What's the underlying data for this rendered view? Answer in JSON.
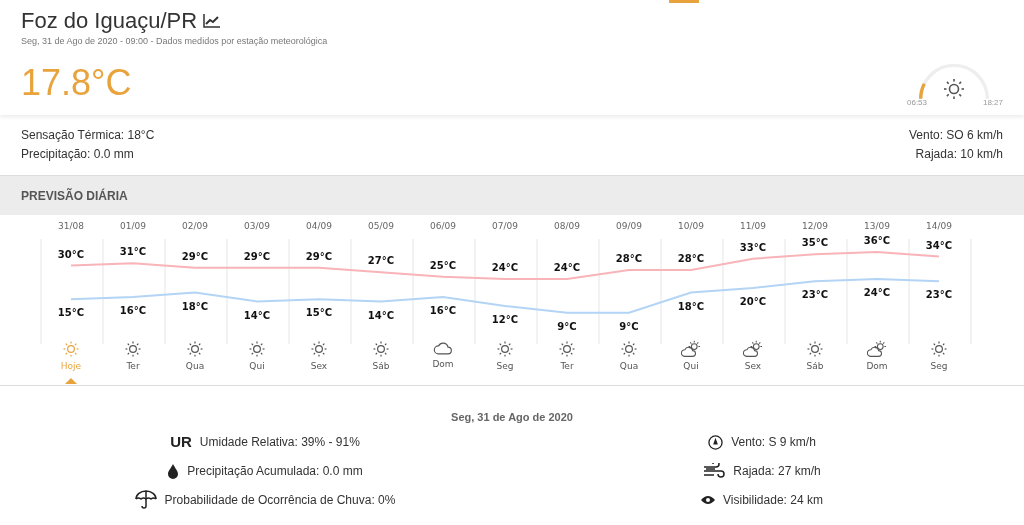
{
  "header": {
    "city": "Foz do Iguaçu/PR",
    "subtitle": "Seg, 31 de Ago de 2020 - 09:00 - Dados medidos por estação meteorológica",
    "temperature": "17.8°C",
    "sun": {
      "level": 0.15,
      "sunrise": "06:53",
      "sunset": "18:27"
    }
  },
  "conditions": {
    "left": [
      "Sensação Térmica: 18°C",
      "Precipitação: 0.0 mm"
    ],
    "right": [
      "Vento: SO 6 km/h",
      "Rajada: 10 km/h"
    ]
  },
  "section_title": "PREVISÃO DIÁRIA",
  "days": [
    {
      "weekday": "Hoje",
      "kind": "sun",
      "selected": true
    },
    {
      "weekday": "Ter",
      "kind": "sun",
      "selected": false
    },
    {
      "weekday": "Qua",
      "kind": "sun",
      "selected": false
    },
    {
      "weekday": "Qui",
      "kind": "sun",
      "selected": false
    },
    {
      "weekday": "Sex",
      "kind": "sun",
      "selected": false
    },
    {
      "weekday": "Sáb",
      "kind": "sun",
      "selected": false
    },
    {
      "weekday": "Dom",
      "kind": "cloud",
      "selected": false
    },
    {
      "weekday": "Seg",
      "kind": "sun",
      "selected": false
    },
    {
      "weekday": "Ter",
      "kind": "sun",
      "selected": false
    },
    {
      "weekday": "Qua",
      "kind": "sun",
      "selected": false
    },
    {
      "weekday": "Qui",
      "kind": "sun-cloud",
      "selected": false
    },
    {
      "weekday": "Sex",
      "kind": "sun-cloud",
      "selected": false
    },
    {
      "weekday": "Sáb",
      "kind": "sun",
      "selected": false
    },
    {
      "weekday": "Dom",
      "kind": "sun-cloud",
      "selected": false
    },
    {
      "weekday": "Seg",
      "kind": "sun",
      "selected": false
    }
  ],
  "chart_data": {
    "type": "line",
    "categories": [
      "31/08",
      "01/09",
      "02/09",
      "03/09",
      "04/09",
      "05/09",
      "06/09",
      "07/09",
      "08/09",
      "09/09",
      "10/09",
      "11/09",
      "12/09",
      "13/09",
      "14/09"
    ],
    "data_labels": true,
    "series": [
      {
        "color": "#f8b4b8",
        "values": [
          30,
          31,
          29,
          29,
          29,
          27,
          25,
          24,
          24,
          28,
          28,
          33,
          35,
          36,
          34
        ],
        "value_labels": [
          "30°C",
          "31°C",
          "29°C",
          "29°C",
          "29°C",
          "27°C",
          "25°C",
          "24°C",
          "24°C",
          "28°C",
          "28°C",
          "33°C",
          "35°C",
          "36°C",
          "34°C"
        ]
      },
      {
        "color": "#b3d4f5",
        "values": [
          15,
          16,
          18,
          14,
          15,
          14,
          16,
          12,
          9,
          9,
          18,
          20,
          23,
          24,
          23
        ],
        "value_labels": [
          "15°C",
          "16°C",
          "18°C",
          "14°C",
          "15°C",
          "14°C",
          "16°C",
          "12°C",
          "9°C",
          "9°C",
          "18°C",
          "20°C",
          "23°C",
          "24°C",
          "23°C"
        ]
      }
    ]
  },
  "details": {
    "date": "Seg, 31 de Ago de 2020",
    "left": [
      {
        "kind": "humidity",
        "label": "UR",
        "text": "Umidade Relativa: 39% - 91%"
      },
      {
        "kind": "drop",
        "text": "Precipitação Acumulada: 0.0 mm"
      },
      {
        "kind": "umbrella",
        "text": "Probabilidade de Ocorrência de Chuva: 0%"
      }
    ],
    "right": [
      {
        "kind": "compass",
        "text": "Vento: S 9 km/h"
      },
      {
        "kind": "wind",
        "text": "Rajada: 27 km/h"
      },
      {
        "kind": "eye",
        "text": "Visibilidade: 24 km"
      }
    ]
  }
}
